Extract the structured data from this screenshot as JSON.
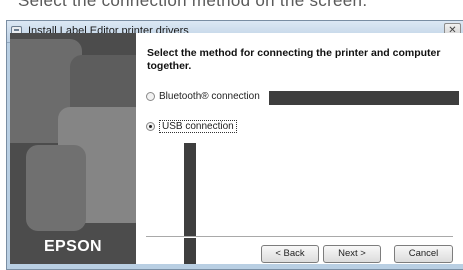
{
  "background_caption": "Select the connection method on the screen.",
  "window": {
    "title": "Install Label Editor printer drivers",
    "app_icon": "printer-icon",
    "close_icon": "close-icon",
    "close_glyph": "✕"
  },
  "sidebar": {
    "brand": "EPSON"
  },
  "main": {
    "heading": "Select the method for connecting the printer and computer together.",
    "options": [
      {
        "label": "Bluetooth® connection",
        "selected": false
      },
      {
        "label": "USB connection",
        "selected": true
      }
    ]
  },
  "buttons": {
    "back": "< Back",
    "next": "Next >",
    "cancel": "Cancel"
  },
  "colors": {
    "window_frame": "#b9cfe3",
    "sidebar_bg": "#4c4c4c",
    "callout": "#3e3e3e"
  }
}
